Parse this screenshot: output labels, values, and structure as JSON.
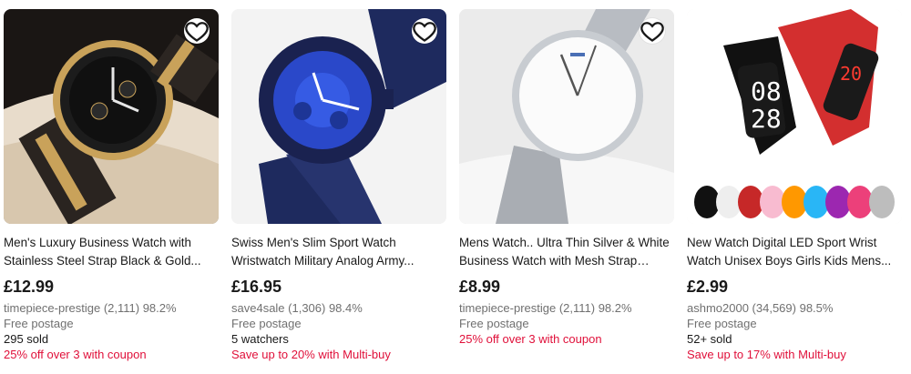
{
  "products": [
    {
      "title": "Men's Luxury Business Watch with Stainless Steel Strap Black & Gold...",
      "price": "£12.99",
      "seller": "timepiece-prestige (2,111) 98.2%",
      "postage": "Free postage",
      "extra": "295 sold",
      "promo": "25% off over 3 with coupon"
    },
    {
      "title": "Swiss Men's Slim Sport Watch Wristwatch Military Analog Army...",
      "price": "£16.95",
      "seller": "save4sale (1,306) 98.4%",
      "postage": "Free postage",
      "extra": "5 watchers",
      "promo": "Save up to 20% with Multi-buy"
    },
    {
      "title": "Mens Watch.. Ultra Thin Silver & White Business Watch with Mesh Strap Quar...",
      "price": "£8.99",
      "seller": "timepiece-prestige (2,111) 98.2%",
      "postage": "Free postage",
      "extra": "",
      "promo": "25% off over 3 with coupon"
    },
    {
      "title": "New Watch Digital LED Sport Wrist Watch Unisex Boys Girls Kids Mens...",
      "price": "£2.99",
      "seller": "ashmo2000 (34,569) 98.5%",
      "postage": "Free postage",
      "extra": "52+ sold",
      "promo": "Save up to 17% with Multi-buy"
    }
  ],
  "colors": {
    "promo": "#e0103a",
    "secondary_text": "#707070",
    "primary_text": "#191919"
  },
  "icons": {
    "wishlist": "heart-outline-icon"
  }
}
